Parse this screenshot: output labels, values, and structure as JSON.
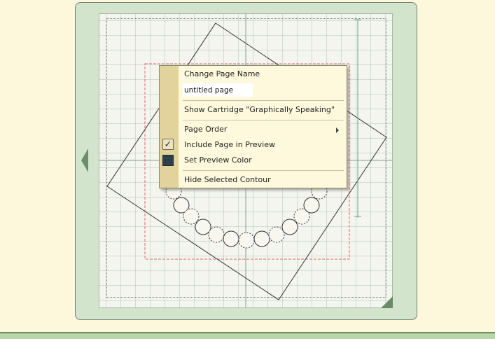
{
  "context_menu": {
    "change_page_name_label": "Change Page Name",
    "page_name_value": "untitled page",
    "show_cartridge_label": "Show Cartridge \"Graphically Speaking\"",
    "page_order_label": "Page Order",
    "include_page_label": "Include Page in Preview",
    "include_page_checked": true,
    "check_glyph": "✓",
    "set_preview_color_label": "Set Preview Color",
    "preview_color": "#2c4148",
    "hide_contour_label": "Hide Selected Contour"
  },
  "colors": {
    "background": "#fdf7dc",
    "mat_frame": "#d3e4cd",
    "selection_box": "#d46a6a",
    "ruler": "#6aa0a0",
    "menu_gutter": "#e2d29c"
  },
  "icons": {
    "prev_page": "left-arrow-icon",
    "corner": "mat-corner-tab-icon",
    "submenu": "chevron-right-icon",
    "check": "check-icon"
  }
}
